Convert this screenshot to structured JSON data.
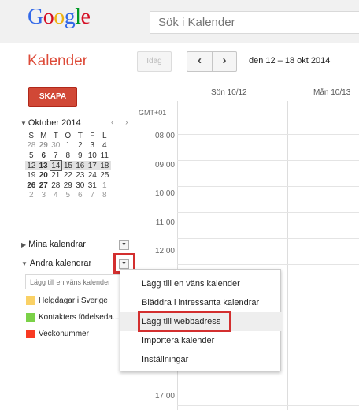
{
  "logo": {
    "letters": [
      "G",
      "o",
      "o",
      "g",
      "l",
      "e"
    ],
    "colors": [
      "#3369e8",
      "#d50f25",
      "#eeb211",
      "#3369e8",
      "#009925",
      "#d50f25"
    ]
  },
  "search": {
    "placeholder": "Sök i Kalender"
  },
  "header": {
    "app_title": "Kalender",
    "today_label": "Idag",
    "prev_icon": "‹",
    "next_icon": "›",
    "date_range": "den 12 – 18 okt 2014"
  },
  "create_label": "SKAPA",
  "mini_calendar": {
    "month": "Oktober 2014",
    "nav": "‹ ›",
    "weekdays": [
      "S",
      "M",
      "T",
      "O",
      "T",
      "F",
      "L"
    ],
    "weeks": [
      [
        "28",
        "29",
        "30",
        "1",
        "2",
        "3",
        "4"
      ],
      [
        "5",
        "6",
        "7",
        "8",
        "9",
        "10",
        "11"
      ],
      [
        "12",
        "13",
        "14",
        "15",
        "16",
        "17",
        "18"
      ],
      [
        "19",
        "20",
        "21",
        "22",
        "23",
        "24",
        "25"
      ],
      [
        "26",
        "27",
        "28",
        "29",
        "30",
        "31",
        "1"
      ],
      [
        "2",
        "3",
        "4",
        "5",
        "6",
        "7",
        "8"
      ]
    ]
  },
  "my_calendars": {
    "label": "Mina kalendrar"
  },
  "other_calendars": {
    "label": "Andra kalendrar",
    "input_placeholder": "Lägg till en väns kalender",
    "items": [
      {
        "label": "Helgdagar i Sverige",
        "color": "#fad165"
      },
      {
        "label": "Kontakters födelseda...",
        "color": "#7bd148"
      },
      {
        "label": "Veckonummer",
        "color": "#f83a22"
      }
    ]
  },
  "grid": {
    "days": [
      "Sön 10/12",
      "Mån 10/13"
    ],
    "timezone": "GMT+01",
    "times": [
      "08:00",
      "09:00",
      "10:00",
      "11:00",
      "12:00",
      "17:00"
    ]
  },
  "menu": {
    "items": [
      "Lägg till en väns kalender",
      "Bläddra i intressanta kalendrar",
      "Lägg till webbadress",
      "Importera kalender",
      "Inställningar"
    ]
  }
}
